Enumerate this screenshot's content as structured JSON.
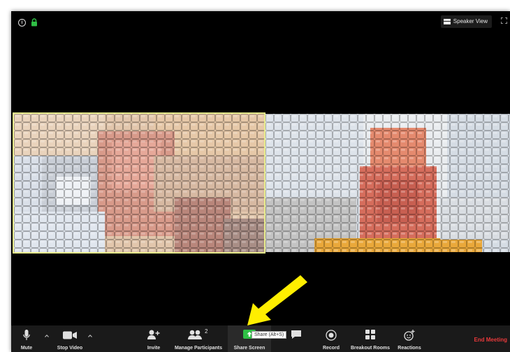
{
  "window": {
    "speaker_view_label": "Speaker View"
  },
  "toolbar": {
    "mute": "Mute",
    "stop_video": "Stop Video",
    "invite": "Invite",
    "manage_participants": "Manage Participants",
    "participant_count": "2",
    "share_screen": "Share Screen",
    "share_tooltip": "Share (Alt+S)",
    "chat": "Chat",
    "record": "Record",
    "breakout_rooms": "Breakout Rooms",
    "reactions": "Reactions",
    "end_meeting": "End Meeting"
  },
  "colors": {
    "share_green": "#2fbf45",
    "end_red": "#e8393b",
    "active_speaker_border": "#e7eb8c",
    "annotation_arrow": "#ffee00"
  },
  "icons": [
    "info-icon",
    "lock-icon",
    "speaker-view-icon",
    "fullscreen-icon",
    "microphone-icon",
    "video-camera-icon",
    "add-person-icon",
    "participants-icon",
    "share-screen-icon",
    "chat-icon",
    "record-icon",
    "breakout-rooms-icon",
    "reactions-icon",
    "caret-up-icon"
  ]
}
